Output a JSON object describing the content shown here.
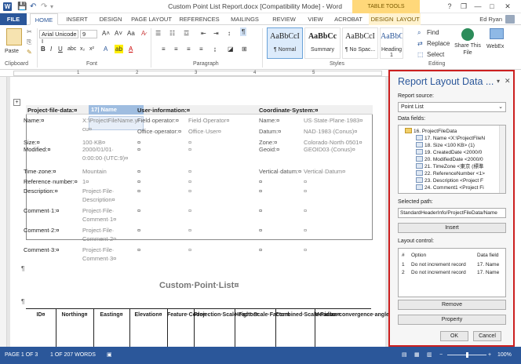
{
  "titlebar": {
    "title": "Custom Point List Report.docx [Compatibility Mode] - Word",
    "table_tools": "TABLE TOOLS",
    "help": "?",
    "restore": "❐",
    "minimize": "—",
    "maximize": "□",
    "close": "✕"
  },
  "tabs": [
    "FILE",
    "HOME",
    "INSERT",
    "DESIGN",
    "PAGE LAYOUT",
    "REFERENCES",
    "MAILINGS",
    "REVIEW",
    "VIEW",
    "ACROBAT",
    "DESIGN",
    "LAYOUT"
  ],
  "user": "Ed Ryan",
  "ribbon": {
    "paste": "Paste",
    "clipboard": "Clipboard",
    "font_name": "Arial Unicode I",
    "font_size": "9",
    "font_label": "Font",
    "paragraph_label": "Paragraph",
    "styles_label": "Styles",
    "styles": [
      {
        "preview": "AaBbCcI",
        "name": "¶ Normal"
      },
      {
        "preview": "AaBbCc",
        "name": "Summary"
      },
      {
        "preview": "AaBbCcI",
        "name": "¶ No Spac..."
      },
      {
        "preview": "AaBbCc",
        "name": "Heading 1"
      }
    ],
    "find": "Find",
    "replace": "Replace",
    "select": "Select",
    "share": "Share This File",
    "webex": "WebEx",
    "editing": "Editing"
  },
  "ruler_numbers": [
    "1",
    "2",
    "3",
    "4",
    "5"
  ],
  "document": {
    "headers": {
      "project": "Project·file·data:¤",
      "name_field": "17| Name",
      "user": "User·information:¤",
      "coord": "Coordinate·System:¤"
    },
    "rows": [
      {
        "c1": "Name:¤",
        "c2": "X:\\ProjectFileName.y",
        "c2b": "cu¤",
        "c3": "Field·operator:¤",
        "c4": "Field·Operator¤",
        "c5": "Name:¤",
        "c6": "US·State·Plane·1983¤"
      },
      {
        "c1": "",
        "c2": "",
        "c3": "Office·operator:¤",
        "c4": "Office·User¤",
        "c5": "Datum:¤",
        "c6": "NAD·1983·(Conus)¤"
      },
      {
        "c1": "Size:¤",
        "c2": "100·KB¤",
        "c3": "¤",
        "c4": "¤",
        "c5": "Zone:¤",
        "c6": "Colorado·North·0501¤"
      },
      {
        "c1": "Modified:¤",
        "c2": "2000/01/01·",
        "c2b": "0:00:00·(UTC:9)¤",
        "c3": "¤",
        "c4": "¤",
        "c5": "Geoid:¤",
        "c6": "GEOID03·(Conus)¤"
      },
      {
        "c1": "Time·zone:¤",
        "c2": "Mountain",
        "c3": "¤",
        "c4": "¤",
        "c5": "Vertical·datum:¤",
        "c6": "Vertical·Datum¤"
      },
      {
        "c1": "Reference·number:¤",
        "c2": "1¤",
        "c3": "¤",
        "c4": "¤",
        "c5": "¤",
        "c6": "¤"
      },
      {
        "c1": "Description:¤",
        "c2": "Project·File·",
        "c2b": "Description¤",
        "c3": "¤",
        "c4": "¤",
        "c5": "¤",
        "c6": "¤"
      },
      {
        "c1": "Comment·1:¤",
        "c2": "Project·File·",
        "c2b": "Comment·1¤",
        "c3": "¤",
        "c4": "¤",
        "c5": "¤",
        "c6": "¤"
      },
      {
        "c1": "Comment·2:¤",
        "c2": "Project·File·",
        "c2b": "Comment·2¤",
        "c3": "¤",
        "c4": "¤",
        "c5": "¤",
        "c6": "¤"
      },
      {
        "c1": "Comment·3:¤",
        "c2": "Project·File·",
        "c2b": "Comment·3¤",
        "c3": "¤",
        "c4": "¤",
        "c5": "¤",
        "c6": "¤"
      }
    ],
    "pilcrow": "¶",
    "point_list_title": "Custom·Point·List¤",
    "columns": [
      "ID¤",
      "Northing¤",
      "Easting¤",
      "Elevation¤",
      "Feature·Code¤",
      "Projection·Scale·Factor¤",
      "Height·Scale·Factor¤",
      "Combined·Scale·Factor¤",
      "Meridian·convergence·angle¤"
    ]
  },
  "panel": {
    "title": "Report Layout Data ...",
    "report_source_label": "Report source:",
    "report_source_value": "Point List",
    "data_fields_label": "Data fields:",
    "tree": [
      {
        "label": "16. ProjectFileData",
        "folder": true
      },
      {
        "label": "17. Name  <X:\\ProjectFileN",
        "folder": false
      },
      {
        "label": "18. Size  <100 KB> (1)",
        "folder": false
      },
      {
        "label": "19. CreatedDate  <2000/0",
        "folder": false
      },
      {
        "label": "20. ModifiedDate  <2000/0",
        "folder": false
      },
      {
        "label": "21. TimeZone  <東京 (標準",
        "folder": false
      },
      {
        "label": "22. ReferenceNumber  <1>",
        "folder": false
      },
      {
        "label": "23. Description  <Project F",
        "folder": false
      },
      {
        "label": "24. Comment1  <Project Fi",
        "folder": false
      }
    ],
    "selected_path_label": "Selected path:",
    "selected_path": "StandardHeaderInfo/ProjectFileData/Name",
    "insert": "Insert",
    "layout_control_label": "Layout control:",
    "layout_headers": [
      "#",
      "Option",
      "Data field"
    ],
    "layout_rows": [
      {
        "n": "1",
        "option": "Do not increment record",
        "field": "17. Name"
      },
      {
        "n": "2",
        "option": "Do not increment record",
        "field": "17. Name"
      }
    ],
    "remove": "Remove",
    "property": "Property",
    "ok": "OK",
    "cancel": "Cancel",
    "close": "✕",
    "dropdown": "▾"
  },
  "statusbar": {
    "page": "PAGE 1 OF 3",
    "words": "1 OF 207 WORDS",
    "zoom": "100%"
  }
}
